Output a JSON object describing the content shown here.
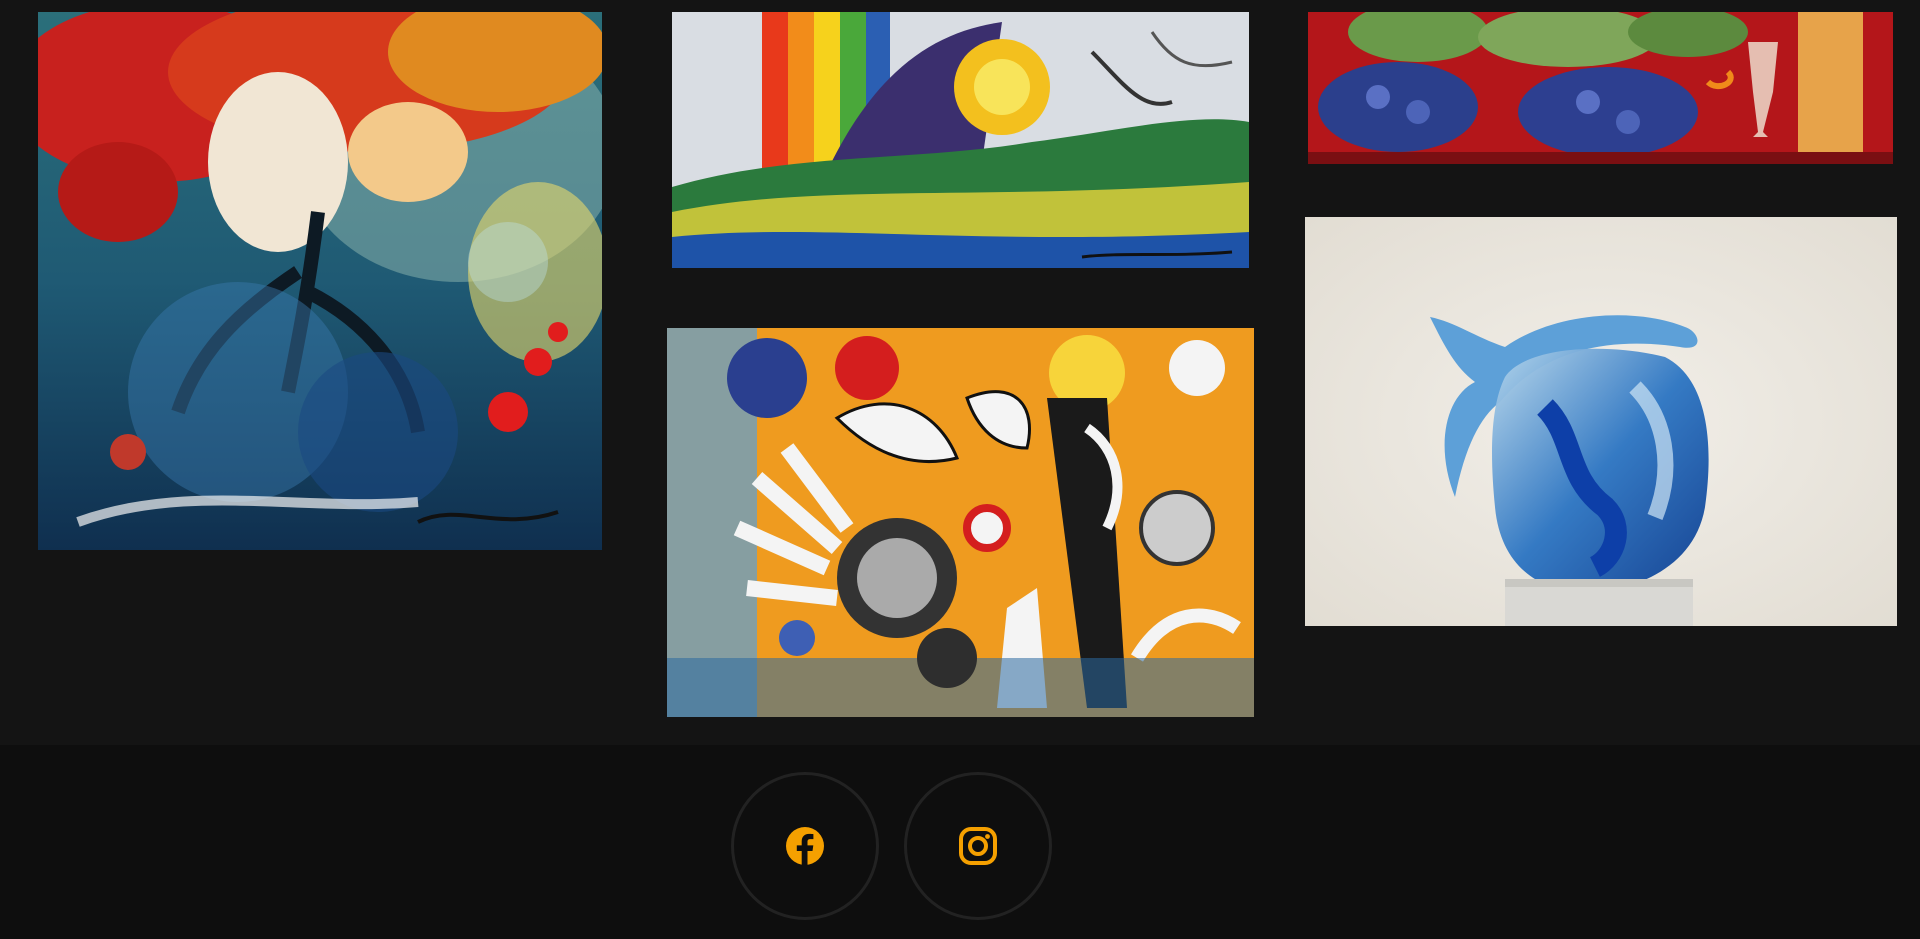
{
  "gallery": {
    "artworks": [
      {
        "subject": "red-blossom-tree-with-fish"
      },
      {
        "subject": "rainbow-sun-landscape"
      },
      {
        "subject": "grapes-and-wine-still-life"
      },
      {
        "subject": "collage-with-doves-and-sun"
      },
      {
        "subject": "blue-glass-dolphin-sculpture"
      }
    ]
  },
  "footer": {
    "social": [
      {
        "icon": "facebook-icon",
        "color": "#f5a000"
      },
      {
        "icon": "instagram-icon",
        "color": "#f5a000"
      }
    ]
  },
  "colors": {
    "page_background": "#141414",
    "footer_background": "#0e0e0e",
    "accent": "#f5a000",
    "circle_border": "#222222"
  }
}
